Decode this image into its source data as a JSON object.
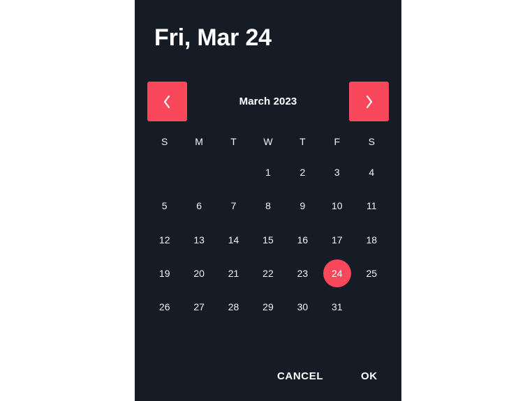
{
  "dialog": {
    "background_color": "#161C26",
    "accent_color": "#F9485B",
    "text_color": "#F2F4F7"
  },
  "header": {
    "selected_date_title": "Fri, Mar 24"
  },
  "month_nav": {
    "prev_label": "‹",
    "next_label": "›",
    "current_month": "March 2023"
  },
  "calendar": {
    "weekdays": [
      "S",
      "M",
      "T",
      "W",
      "T",
      "F",
      "S"
    ],
    "selected_day": 24,
    "weeks": [
      [
        "",
        "",
        "",
        "1",
        "2",
        "3",
        "4"
      ],
      [
        "5",
        "6",
        "7",
        "8",
        "9",
        "10",
        "11"
      ],
      [
        "12",
        "13",
        "14",
        "15",
        "16",
        "17",
        "18"
      ],
      [
        "19",
        "20",
        "21",
        "22",
        "23",
        "24",
        "25"
      ],
      [
        "26",
        "27",
        "28",
        "29",
        "30",
        "31",
        ""
      ]
    ]
  },
  "actions": {
    "cancel_label": "CANCEL",
    "ok_label": "OK"
  }
}
